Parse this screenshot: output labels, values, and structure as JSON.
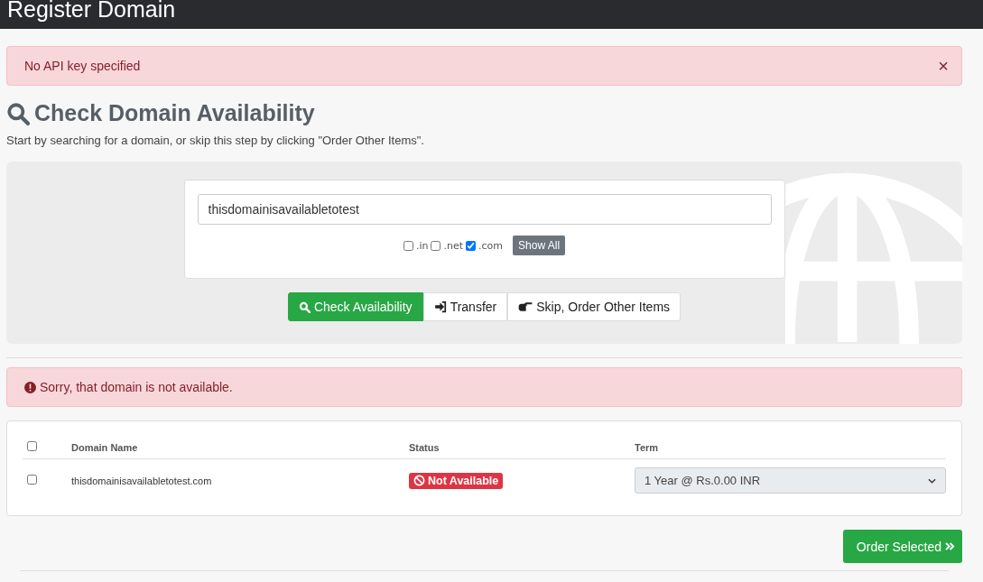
{
  "header": {
    "title": "Register Domain"
  },
  "alert": {
    "message": "No API key specified",
    "close": "×"
  },
  "heading": "Check Domain Availability",
  "subtitle": "Start by searching for a domain, or skip this step by clicking \"Order Other Items\".",
  "search": {
    "value": "thisdomainisavailabletotest"
  },
  "tlds": [
    {
      "label": ".in",
      "checked": false
    },
    {
      "label": ".net",
      "checked": false
    },
    {
      "label": ".com",
      "checked": true
    }
  ],
  "show_all": "Show All",
  "actions": [
    {
      "kind": "check",
      "label": "Check Availability"
    },
    {
      "kind": "transfer",
      "label": "Transfer"
    },
    {
      "kind": "skip",
      "label": "Skip, Order Other Items"
    }
  ],
  "result_alert": "Sorry, that domain is not available.",
  "table": {
    "select_all": {
      "checked": false
    },
    "columns": [
      "Domain Name",
      "Status",
      "Term"
    ],
    "rows": [
      {
        "checked": false,
        "domain": "thisdomainisavailabletotest.com",
        "status": {
          "kind": "unavailable",
          "label": "Not Available"
        },
        "term": "1 Year @ Rs.0.00 INR"
      }
    ]
  },
  "order_button": "Order Selected"
}
